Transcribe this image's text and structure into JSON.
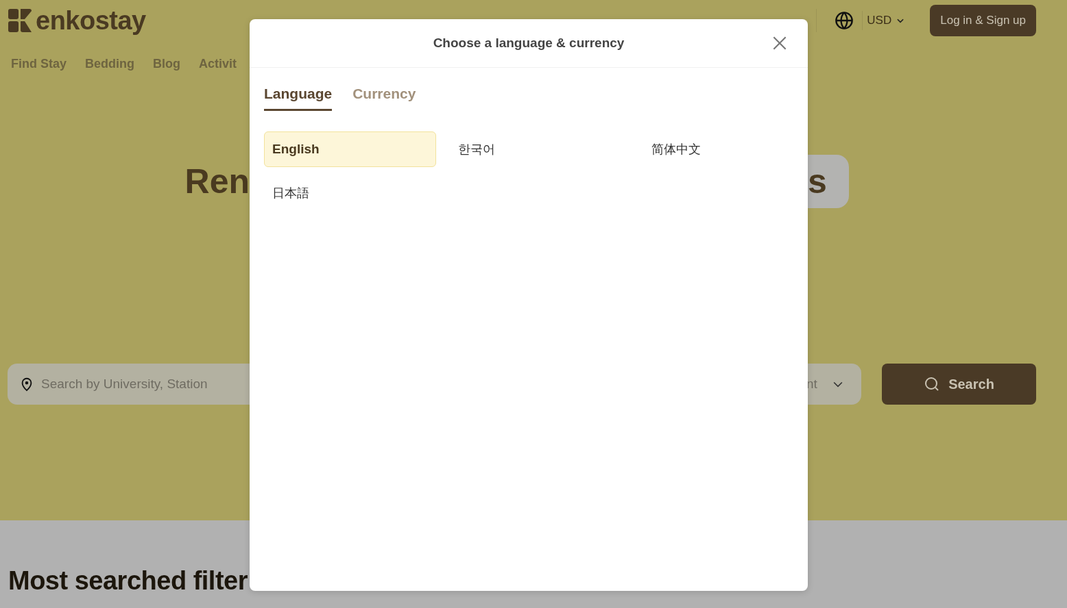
{
  "header": {
    "logo": "enkostay",
    "nav": [
      "Find Stay",
      "Bedding",
      "Blog",
      "Activit"
    ],
    "currency": "USD",
    "login_button": "Log in & Sign up"
  },
  "hero": {
    "title_left": "Ren",
    "title_right": "s"
  },
  "search": {
    "placeholder": "Search by University, Station",
    "filter_fragment": "nt",
    "button": "Search"
  },
  "section": {
    "title": "Most searched filter"
  },
  "modal": {
    "title": "Choose a language & currency",
    "tabs": [
      {
        "label": "Language",
        "selected": true
      },
      {
        "label": "Currency",
        "selected": false
      }
    ],
    "languages": [
      {
        "label": "English",
        "selected": true
      },
      {
        "label": "한국어",
        "selected": false
      },
      {
        "label": "简体中文",
        "selected": false
      },
      {
        "label": "日本語",
        "selected": false
      }
    ]
  }
}
